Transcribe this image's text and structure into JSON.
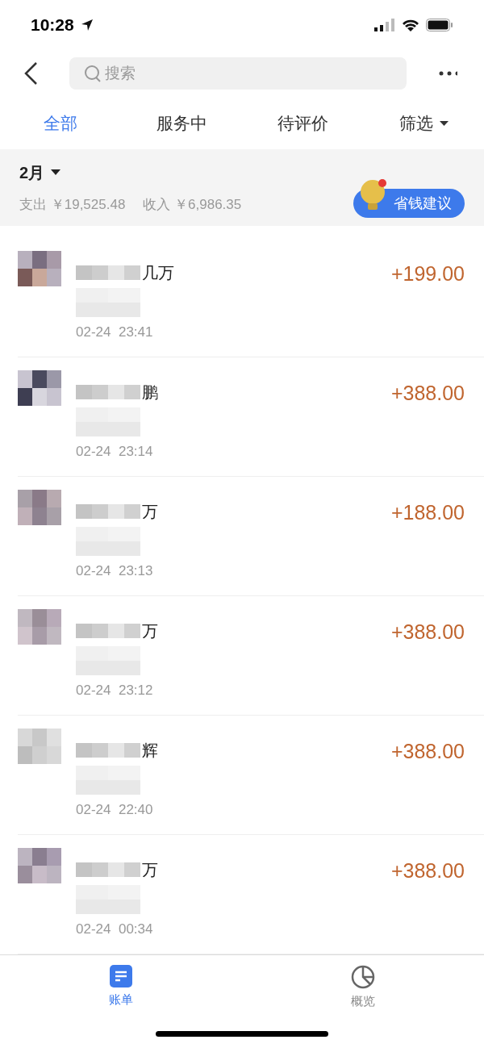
{
  "status_bar": {
    "time": "10:28"
  },
  "search": {
    "placeholder": "搜索"
  },
  "tabs": [
    {
      "label": "全部",
      "selected": true
    },
    {
      "label": "服务中",
      "selected": false
    },
    {
      "label": "待评价",
      "selected": false
    },
    {
      "label": "筛选",
      "selected": false,
      "dropdown": true
    }
  ],
  "summary": {
    "month": "2月",
    "expense_label": "支出",
    "expense": "￥19,525.48",
    "income_label": "收入",
    "income": "￥6,986.35",
    "tip_button": "省钱建议"
  },
  "transactions": [
    {
      "name_fragment": "几万",
      "amount": "+199.00",
      "time": "02-24  23:41"
    },
    {
      "name_fragment": "鹏",
      "amount": "+388.00",
      "time": "02-24  23:14"
    },
    {
      "name_fragment": "万",
      "amount": "+188.00",
      "time": "02-24  23:13"
    },
    {
      "name_fragment": "万",
      "amount": "+388.00",
      "time": "02-24  23:12"
    },
    {
      "name_fragment": "辉",
      "amount": "+388.00",
      "time": "02-24  22:40"
    },
    {
      "name_fragment": "万",
      "amount": "+388.00",
      "time": "02-24  00:34"
    }
  ],
  "bottom_nav": [
    {
      "label": "账单",
      "selected": true
    },
    {
      "label": "概览",
      "selected": false
    }
  ]
}
